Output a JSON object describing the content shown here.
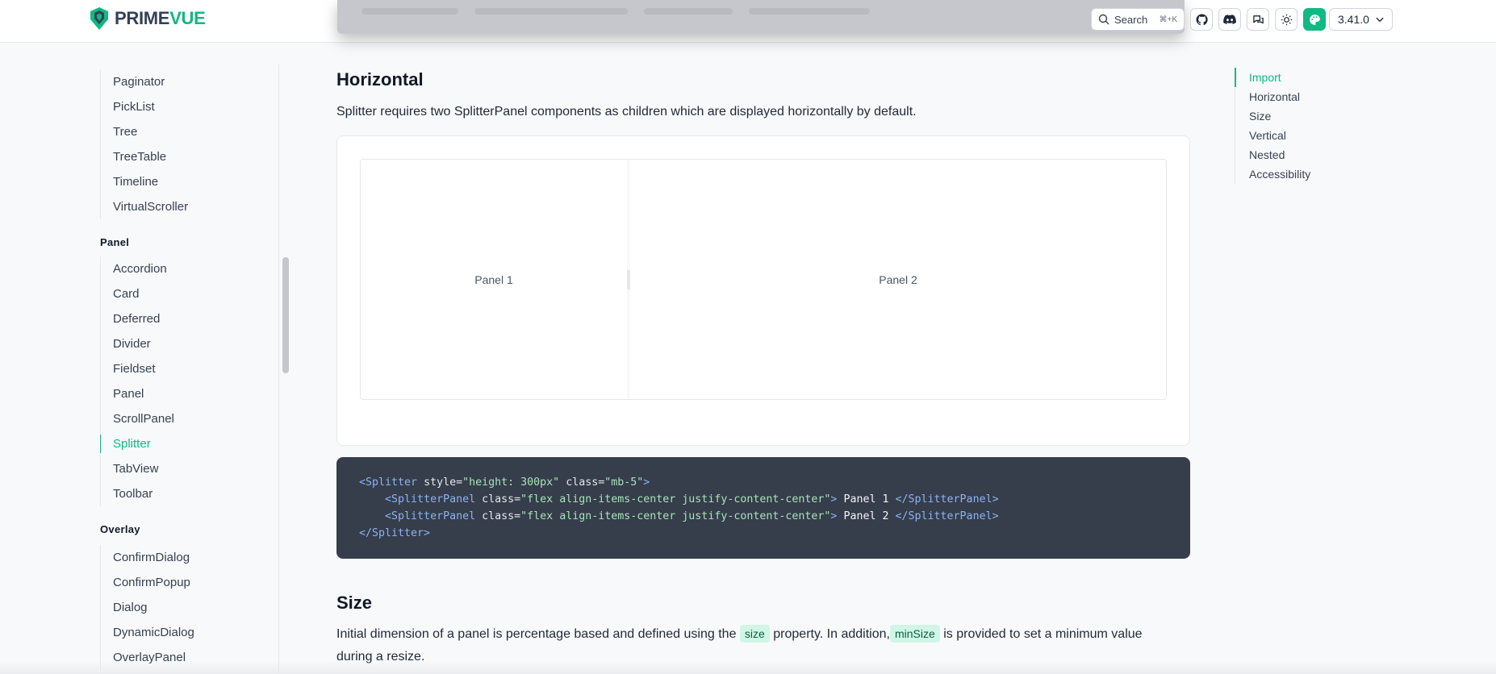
{
  "header": {
    "logo_prime": "PRIME",
    "logo_vue": "VUE",
    "search_label": "Search",
    "search_shortcut": "⌘+K",
    "version": "3.41.0",
    "icons": [
      "github-icon",
      "discord-icon",
      "forum-icon",
      "sun-icon",
      "palette-icon"
    ]
  },
  "sidebar": {
    "data_items": [
      "Paginator",
      "PickList",
      "Tree",
      "TreeTable",
      "Timeline",
      "VirtualScroller"
    ],
    "panel_heading": "Panel",
    "panel_items": [
      "Accordion",
      "Card",
      "Deferred",
      "Divider",
      "Fieldset",
      "Panel",
      "ScrollPanel",
      "Splitter",
      "TabView",
      "Toolbar"
    ],
    "active_item": "Splitter",
    "overlay_heading": "Overlay",
    "overlay_items": [
      "ConfirmDialog",
      "ConfirmPopup",
      "Dialog",
      "DynamicDialog",
      "OverlayPanel"
    ]
  },
  "main": {
    "horizontal_title": "Horizontal",
    "horizontal_desc": "Splitter requires two SplitterPanel components as children which are displayed horizontally by default.",
    "panel1_label": "Panel 1",
    "panel2_label": "Panel 2",
    "code": {
      "l1_open": "<Splitter",
      "l1_attr1": " style=",
      "l1_val1": "\"height: 300px\"",
      "l1_attr2": " class=",
      "l1_val2": "\"mb-5\"",
      "l1_close": ">",
      "sp_open": "<SplitterPanel",
      "sp_attr": " class=",
      "sp_val": "\"flex align-items-center justify-content-center\"",
      "sp_gt": ">",
      "sp_text1": " Panel 1 ",
      "sp_text2": " Panel 2 ",
      "sp_close": "</SplitterPanel>",
      "l4": "</Splitter>"
    },
    "size_title": "Size",
    "size_desc_1": "Initial dimension of a panel is percentage based and defined using the",
    "size_chip": "size",
    "size_desc_2": "property. In addition,",
    "minsize_chip": "minSize",
    "size_desc_3": "is provided to set a minimum value",
    "size_desc_4": "during a resize."
  },
  "toc": {
    "items": [
      "Import",
      "Horizontal",
      "Size",
      "Vertical",
      "Nested",
      "Accessibility"
    ],
    "active": "Import"
  },
  "colors": {
    "accent": "#10b981",
    "code_bg": "#363d4b",
    "chip_bg": "#d1f5e6"
  }
}
